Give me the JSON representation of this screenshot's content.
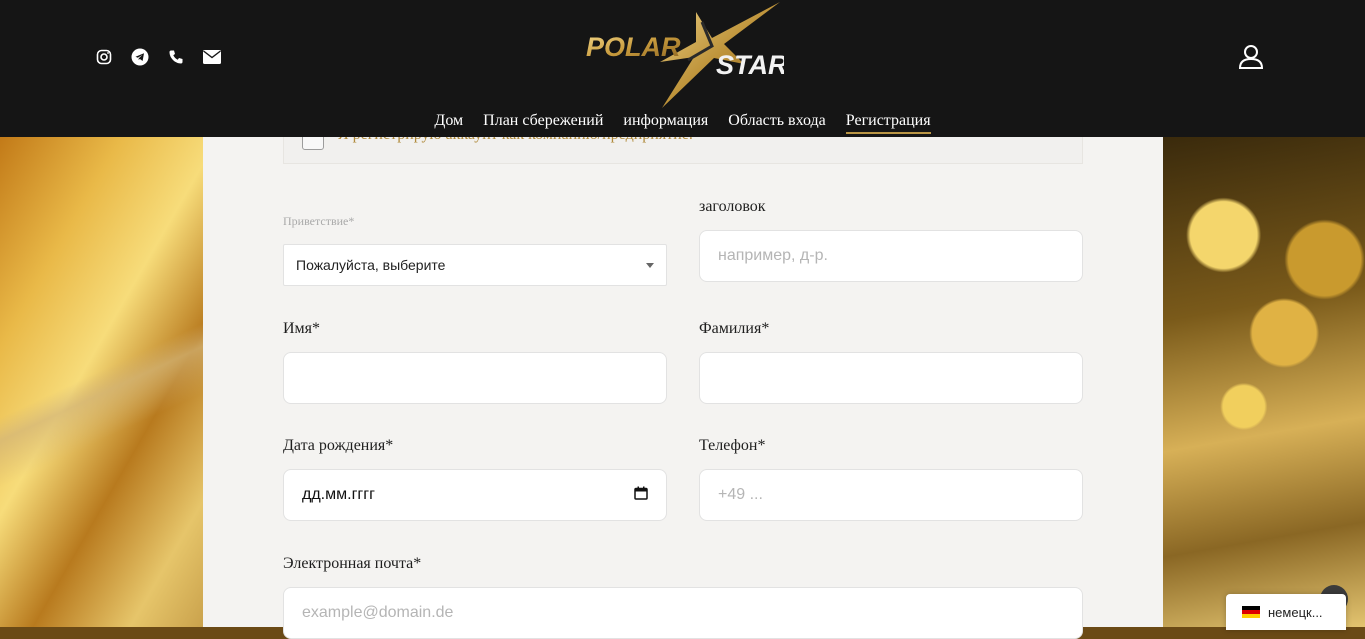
{
  "header": {
    "social_icons": [
      "instagram-icon",
      "telegram-icon",
      "phone-icon",
      "envelope-icon"
    ],
    "logo_text": "POLAR STAR",
    "account_icon": "user-icon",
    "nav": [
      {
        "label": "Дом"
      },
      {
        "label": "План сбережений"
      },
      {
        "label": "информация"
      },
      {
        "label": "Область входа"
      },
      {
        "label": "Регистрация",
        "active": true
      }
    ]
  },
  "form": {
    "company_checkbox_label": "Я регистрирую аккаунт как компанию/предприятие.",
    "salutation": {
      "label": "Приветствие*",
      "value": "Пожалуйста, выберите"
    },
    "title": {
      "label": "заголовок",
      "placeholder": "например, д-р."
    },
    "first_name": {
      "label": "Имя*",
      "placeholder": ""
    },
    "last_name": {
      "label": "Фамилия*",
      "placeholder": ""
    },
    "birthdate": {
      "label": "Дата рождения*",
      "placeholder": "дд.мм.гггг"
    },
    "phone": {
      "label": "Телефон*",
      "placeholder": "+49 ..."
    },
    "email": {
      "label": "Электронная почта*",
      "placeholder": "example@domain.de"
    }
  },
  "language_widget": {
    "label": "немецк...",
    "flag_colors": [
      "#000000",
      "#dd0000",
      "#ffce00"
    ]
  },
  "colors": {
    "header_bg": "#151515",
    "accent_gold": "#b99544",
    "panel_bg": "#f4f3f1"
  }
}
